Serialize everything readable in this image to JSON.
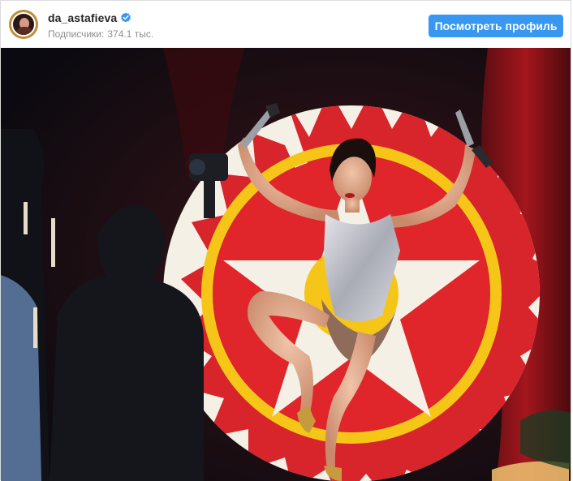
{
  "header": {
    "username": "da_astafieva",
    "verified_icon": "verified-badge-icon",
    "followers_label": "Подписчики:",
    "followers_count": "374.1 тыс.",
    "view_profile_button": "Посмотреть профиль"
  },
  "post": {
    "image_icon": "post-photo"
  },
  "colors": {
    "button_blue": "#3897f0",
    "username_text": "#262626",
    "muted_text": "#8e8e8e",
    "target_red": "#e0262a",
    "target_yellow": "#f5c518"
  }
}
